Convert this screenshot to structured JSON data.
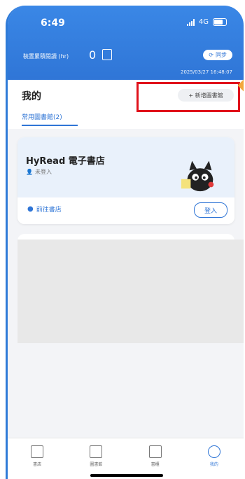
{
  "status": {
    "time": "6:49",
    "network": "4G"
  },
  "header": {
    "reading_label": "裝置累積閱讀 (hr)",
    "reading_count": "0",
    "sync_label": "同步",
    "timestamp": "2025/03/27 16:48:07"
  },
  "page": {
    "title": "我的",
    "add_library_label": "+ 新增圖書館",
    "tab_label": "常用圖書館(2)"
  },
  "library_card": {
    "title": "HyRead 電子書店",
    "login_state": "未登入",
    "store_link_label": "前往書店",
    "login_label": "登入"
  },
  "nav": {
    "items": [
      {
        "label": "書店"
      },
      {
        "label": "圖書館"
      },
      {
        "label": "書櫃"
      },
      {
        "label": "我的"
      }
    ]
  },
  "colors": {
    "accent": "#2f75d6",
    "highlight": "#e0121b"
  }
}
